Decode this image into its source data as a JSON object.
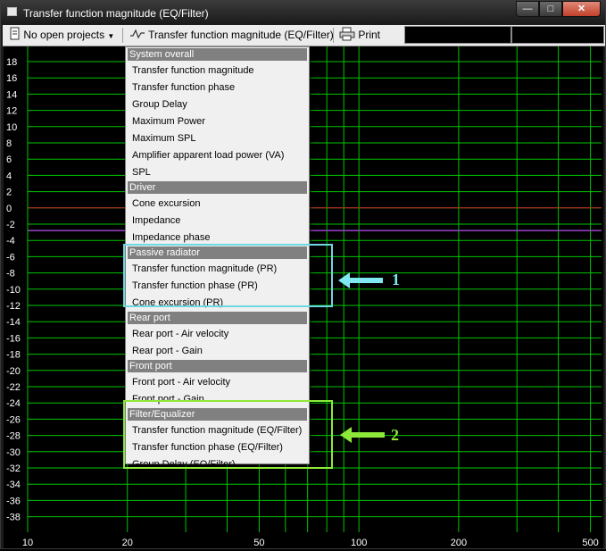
{
  "window": {
    "title": "Transfer function magnitude (EQ/Filter)",
    "controls": {
      "minimize": "—",
      "maximize": "□",
      "close": "✕"
    }
  },
  "toolbar": {
    "project_label": "No open projects",
    "graph_label": "Transfer function magnitude (EQ/Filter)",
    "print_label": "Print",
    "project_icon": "document-icon",
    "graph_icon": "waveform-icon",
    "print_icon": "printer-icon"
  },
  "graph": {
    "y_ticks": [
      "18",
      "16",
      "14",
      "12",
      "10",
      "8",
      "6",
      "4",
      "2",
      "0",
      "-2",
      "-4",
      "-6",
      "-8",
      "-10",
      "-12",
      "-14",
      "-16",
      "-18",
      "-20",
      "-22",
      "-24",
      "-26",
      "-28",
      "-30",
      "-32",
      "-34",
      "-36",
      "-38"
    ],
    "x_ticks": [
      "10",
      "20",
      "50",
      "100",
      "200",
      "500"
    ],
    "colors": {
      "grid": "#00c400",
      "zero_line": "#cc2222",
      "trace": "#9a40c8",
      "background": "#000000"
    }
  },
  "menu": {
    "sections": [
      {
        "header": "System overall",
        "items": [
          "Transfer function magnitude",
          "Transfer function phase",
          "Group Delay",
          "Maximum Power",
          "Maximum SPL",
          "Amplifier apparent load power (VA)",
          "SPL"
        ]
      },
      {
        "header": "Driver",
        "items": [
          "Cone excursion",
          "Impedance",
          "Impedance phase"
        ]
      },
      {
        "header": "Passive radiator",
        "items": [
          "Transfer function magnitude (PR)",
          "Transfer function phase (PR)",
          "Cone excursion (PR)"
        ]
      },
      {
        "header": "Rear port",
        "items": [
          "Rear port - Air velocity",
          "Rear port - Gain"
        ]
      },
      {
        "header": "Front port",
        "items": [
          "Front port - Air velocity",
          "Front port - Gain"
        ]
      },
      {
        "header": "Filter/Equalizer",
        "items": [
          "Transfer function magnitude (EQ/Filter)",
          "Transfer function phase (EQ/Filter)",
          "Group Delay (EQ/Filter)"
        ]
      }
    ]
  },
  "annotations": [
    {
      "label": "1",
      "color": "#7fe8f0"
    },
    {
      "label": "2",
      "color": "#8ee83a"
    }
  ]
}
